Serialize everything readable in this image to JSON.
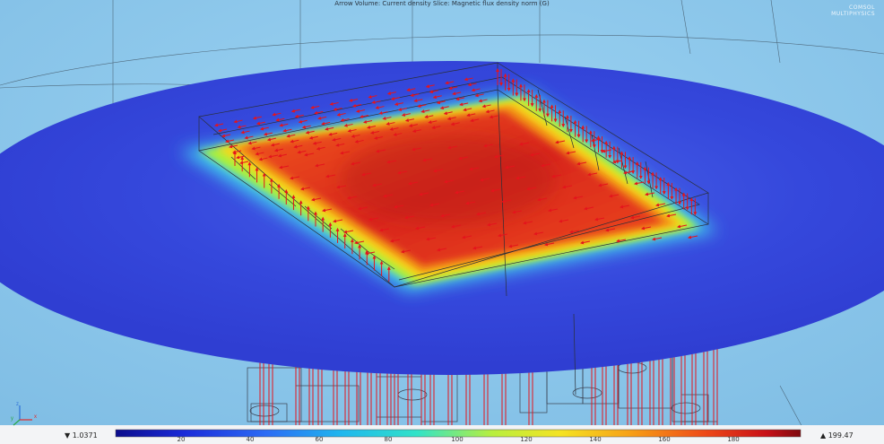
{
  "title": "Arrow Volume: Current density  Slice: Magnetic flux density norm (G)",
  "logo": {
    "line1": "COMSOL",
    "line2": "MULTIPHYSICS"
  },
  "colorbar": {
    "min_label": "▼ 1.0371",
    "max_label": "▲ 199.47",
    "ticks": [
      "20",
      "40",
      "60",
      "80",
      "100",
      "120",
      "140",
      "160",
      "180"
    ],
    "colormap": "rainbow"
  },
  "axis_triad": {
    "z": "z",
    "y": "y",
    "x": "x"
  },
  "colors": {
    "background": "#8ec7ea",
    "disk": "#3a4ee0",
    "arrow": "#e4141c",
    "wire": "#2a2f38"
  }
}
